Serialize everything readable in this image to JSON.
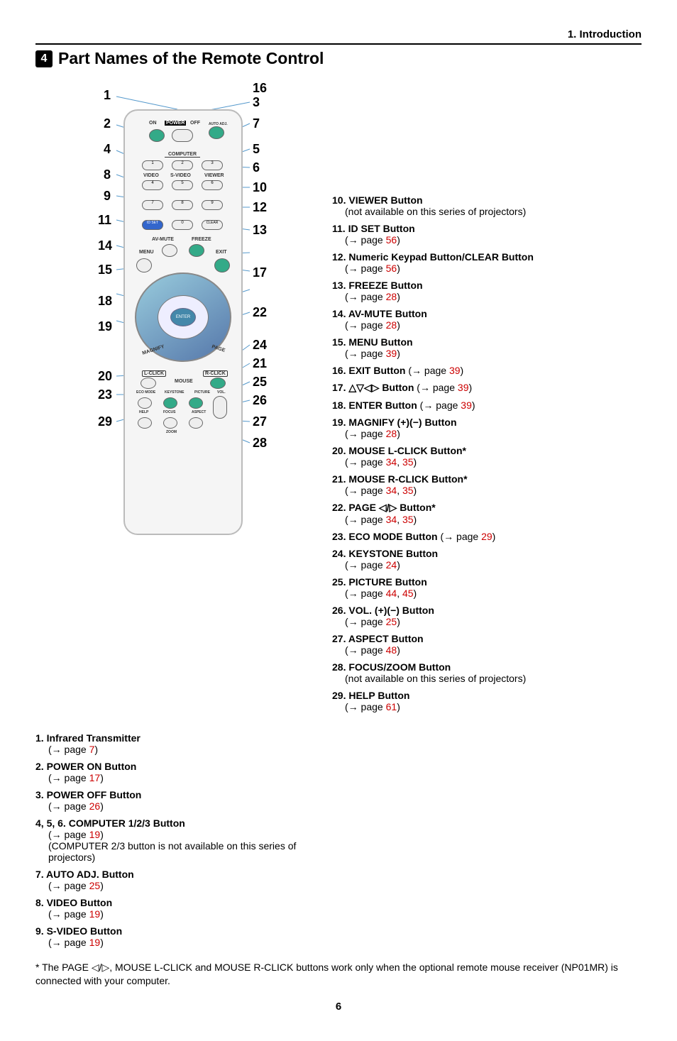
{
  "chapter": "1. Introduction",
  "section_num": "4",
  "section_title": "Part Names of the Remote Control",
  "callouts": {
    "c1": "1",
    "c2": "2",
    "c3": "3",
    "c4": "4",
    "c5": "5",
    "c6": "6",
    "c7": "7",
    "c8": "8",
    "c9": "9",
    "c10": "10",
    "c11": "11",
    "c12": "12",
    "c13": "13",
    "c14": "14",
    "c15": "15",
    "c16": "16",
    "c17": "17",
    "c18": "18",
    "c19": "19",
    "c20": "20",
    "c21": "21",
    "c22": "22",
    "c23": "23",
    "c24": "24",
    "c25": "25",
    "c26": "26",
    "c27": "27",
    "c28": "28",
    "c29": "29"
  },
  "remote_labels": {
    "on": "ON",
    "power": "POWER",
    "off": "OFF",
    "auto": "AUTO ADJ.",
    "computer": "COMPUTER",
    "video": "VIDEO",
    "svideo": "S-VIDEO",
    "viewer": "VIEWER",
    "idset": "ID SET",
    "clear": "CLEAR",
    "avmute": "AV-MUTE",
    "freeze": "FREEZE",
    "menu": "MENU",
    "exit": "EXIT",
    "enter": "ENTER",
    "magnify": "MAGNIFY",
    "page_lbl": "PAGE",
    "lclick": "L-CLICK",
    "rclick": "R-CLICK",
    "mouse": "MOUSE",
    "eco": "ECO MODE",
    "keystone": "KEYSTONE",
    "picture": "PICTURE",
    "help": "HELP",
    "focus": "FOCUS",
    "aspect": "ASPECT",
    "vol": "VOL.",
    "zoom": "ZOOM",
    "n0": "0",
    "n1": "1",
    "n2": "2",
    "n3": "3",
    "n4": "4",
    "n5": "5",
    "n6": "6",
    "n7": "7",
    "n8": "8",
    "n9": "9"
  },
  "left_col": [
    {
      "num": "1.",
      "title": "Infrared Transmitter",
      "refs": [
        {
          "text": "7"
        }
      ]
    },
    {
      "num": "2.",
      "title": "POWER ON Button",
      "refs": [
        {
          "text": "17"
        }
      ]
    },
    {
      "num": "3.",
      "title": "POWER OFF Button",
      "refs": [
        {
          "text": "26"
        }
      ]
    },
    {
      "num": "4, 5, 6.",
      "title": "COMPUTER 1/2/3 Button",
      "refs": [
        {
          "text": "19"
        }
      ],
      "note": "(COMPUTER 2/3 button is not available on this series of projectors)"
    },
    {
      "num": "7.",
      "title": "AUTO ADJ. Button",
      "refs": [
        {
          "text": "25"
        }
      ]
    },
    {
      "num": "8.",
      "title": "VIDEO Button",
      "refs": [
        {
          "text": "19"
        }
      ]
    },
    {
      "num": "9.",
      "title": "S-VIDEO Button",
      "refs": [
        {
          "text": "19"
        }
      ]
    }
  ],
  "right_col_top": [
    {
      "num": "10.",
      "title": "VIEWER Button",
      "note_inline": "(not available on this series of projectors)"
    },
    {
      "num": "11.",
      "title": "ID SET Button",
      "refs": [
        {
          "text": "56"
        }
      ]
    },
    {
      "num": "12.",
      "title": "Numeric Keypad Button/CLEAR Button",
      "refs": [
        {
          "text": "56"
        }
      ]
    },
    {
      "num": "13.",
      "title": "FREEZE Button",
      "refs": [
        {
          "text": "28"
        }
      ]
    },
    {
      "num": "14.",
      "title": "AV-MUTE Button",
      "refs": [
        {
          "text": "28"
        }
      ]
    },
    {
      "num": "15.",
      "title": "MENU Button",
      "refs": [
        {
          "text": "39"
        }
      ]
    },
    {
      "num": "16.",
      "title": "EXIT Button",
      "inline_ref": "39"
    },
    {
      "num": "17.",
      "title": "△▽◁▷ Button",
      "inline_ref": "39"
    },
    {
      "num": "18.",
      "title": "ENTER Button",
      "inline_ref": "39"
    },
    {
      "num": "19.",
      "title": "MAGNIFY (+)(−) Button",
      "refs": [
        {
          "text": "28"
        }
      ]
    },
    {
      "num": "20.",
      "title": "MOUSE L-CLICK Button*",
      "refs": [
        {
          "text": "34"
        },
        {
          "text": "35"
        }
      ]
    },
    {
      "num": "21.",
      "title": "MOUSE R-CLICK Button*",
      "refs": [
        {
          "text": "34"
        },
        {
          "text": "35"
        }
      ]
    },
    {
      "num": "22.",
      "title": "PAGE ◁/▷ Button*",
      "refs": [
        {
          "text": "34"
        },
        {
          "text": "35"
        }
      ]
    },
    {
      "num": "23.",
      "title": "ECO MODE Button",
      "inline_ref": "29"
    },
    {
      "num": "24.",
      "title": "KEYSTONE Button",
      "refs": [
        {
          "text": "24"
        }
      ]
    },
    {
      "num": "25.",
      "title": "PICTURE Button",
      "refs": [
        {
          "text": "44"
        },
        {
          "text": "45"
        }
      ]
    },
    {
      "num": "26.",
      "title": "VOL. (+)(−) Button",
      "refs": [
        {
          "text": "25"
        }
      ]
    },
    {
      "num": "27.",
      "title": "ASPECT Button",
      "refs": [
        {
          "text": "48"
        }
      ]
    },
    {
      "num": "28.",
      "title": "FOCUS/ZOOM Button",
      "note_inline": "(not available on this series of projectors)"
    },
    {
      "num": "29.",
      "title": "HELP Button",
      "refs": [
        {
          "text": "61"
        }
      ]
    }
  ],
  "arrow_text": "→ page ",
  "footnote": "*  The PAGE ◁/▷, MOUSE L-CLICK and MOUSE R-CLICK buttons work only when the optional remote mouse receiver (NP01MR) is connected with your computer.",
  "page_number": "6"
}
